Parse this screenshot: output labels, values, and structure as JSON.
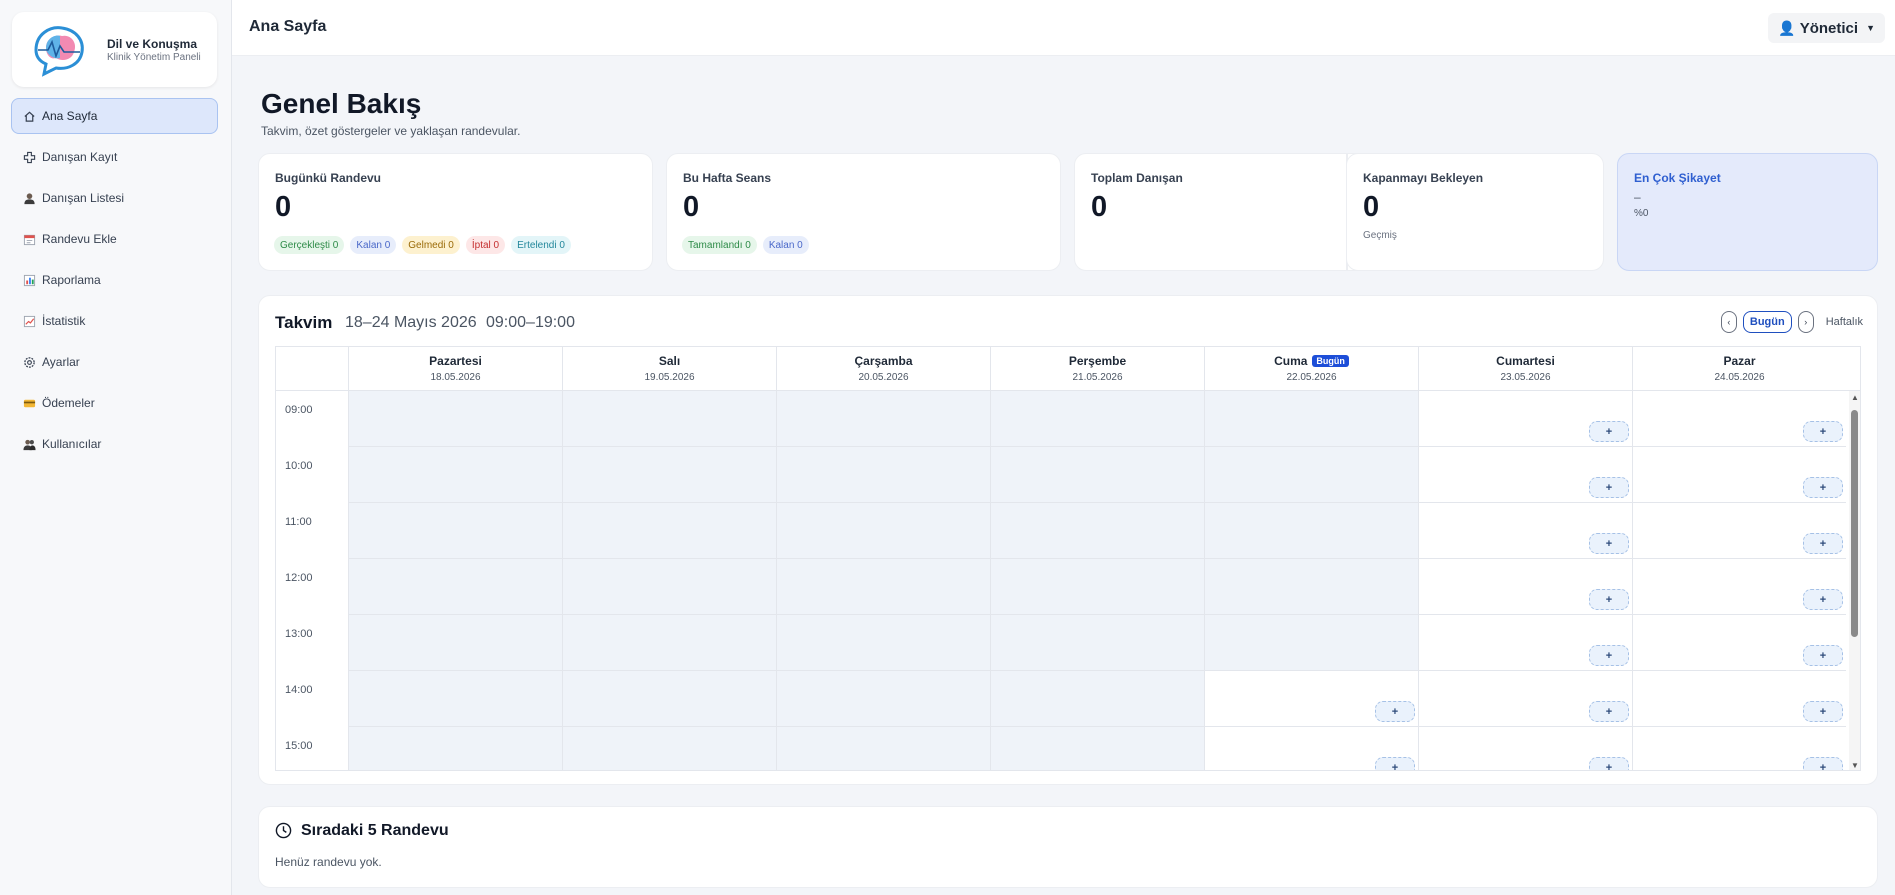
{
  "brand": {
    "title": "Dil ve Konuşma",
    "subtitle": "Klinik Yönetim Paneli"
  },
  "sidebar": {
    "items": [
      {
        "label": "Ana Sayfa",
        "icon": "home-icon",
        "active": true
      },
      {
        "label": "Danışan Kayıt",
        "icon": "plus-cross-icon"
      },
      {
        "label": "Danışan Listesi",
        "icon": "person-icon"
      },
      {
        "label": "Randevu Ekle",
        "icon": "calendar-icon"
      },
      {
        "label": "Raporlama",
        "icon": "bar-chart-icon"
      },
      {
        "label": "İstatistik",
        "icon": "trend-chart-icon"
      },
      {
        "label": "Ayarlar",
        "icon": "gear-icon"
      },
      {
        "label": "Ödemeler",
        "icon": "credit-card-icon"
      },
      {
        "label": "Kullanıcılar",
        "icon": "users-icon"
      }
    ]
  },
  "topbar": {
    "title": "Ana Sayfa",
    "user": "Yönetici"
  },
  "header": {
    "title": "Genel Bakış",
    "subtitle": "Takvim, özet göstergeler ve yaklaşan randevular."
  },
  "stats": {
    "today": {
      "label": "Bugünkü Randevu",
      "value": "0",
      "pills": [
        {
          "text": "Gerçekleşti 0",
          "color": "green"
        },
        {
          "text": "Kalan 0",
          "color": "blue"
        },
        {
          "text": "Gelmedi 0",
          "color": "yellow"
        },
        {
          "text": "İptal 0",
          "color": "red"
        },
        {
          "text": "Ertelendi 0",
          "color": "cyan"
        }
      ]
    },
    "week": {
      "label": "Bu Hafta Seans",
      "value": "0",
      "pills": [
        {
          "text": "Tamamlandı 0",
          "color": "green"
        },
        {
          "text": "Kalan 0",
          "color": "blue"
        }
      ]
    },
    "total": {
      "label": "Toplam Danışan",
      "value": "0"
    },
    "pending": {
      "label": "Kapanmayı Bekleyen",
      "value": "0",
      "note": "Geçmiş"
    },
    "complaint": {
      "label": "En Çok Şikayet",
      "value": "–",
      "percent": "%0"
    }
  },
  "calendar": {
    "title": "Takvim",
    "range": "18–24 Mayıs 2026",
    "hours": "09:00–19:00",
    "prev": "‹",
    "today_button": "Bugün",
    "next": "›",
    "view": "Haftalık",
    "today_badge": "Bugün",
    "add_label": "+",
    "days": [
      {
        "name": "Pazartesi",
        "date": "18.05.2026"
      },
      {
        "name": "Salı",
        "date": "19.05.2026"
      },
      {
        "name": "Çarşamba",
        "date": "20.05.2026"
      },
      {
        "name": "Perşembe",
        "date": "21.05.2026"
      },
      {
        "name": "Cuma",
        "date": "22.05.2026",
        "today": true
      },
      {
        "name": "Cumartesi",
        "date": "23.05.2026"
      },
      {
        "name": "Pazar",
        "date": "24.05.2026"
      }
    ],
    "times": [
      "09:00",
      "10:00",
      "11:00",
      "12:00",
      "13:00",
      "14:00",
      "15:00"
    ],
    "today_index": 4,
    "now_hour_index": 5
  },
  "upcoming": {
    "title": "Sıradaki 5 Randevu",
    "empty": "Henüz randevu yok."
  }
}
